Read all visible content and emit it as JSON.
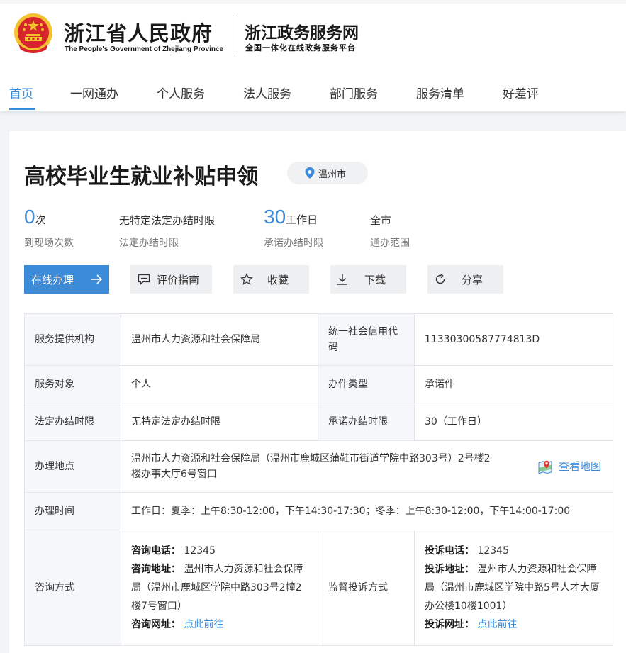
{
  "header": {
    "gov_name": "浙江省人民政府",
    "gov_name_en": "The People's Government of Zhejiang Province",
    "portal_name": "浙江政务服务网",
    "portal_subtitle": "全国一体化在线政务服务平台"
  },
  "nav": {
    "items": [
      {
        "label": "首页",
        "active": true
      },
      {
        "label": "一网通办"
      },
      {
        "label": "个人服务"
      },
      {
        "label": "法人服务"
      },
      {
        "label": "部门服务"
      },
      {
        "label": "服务清单"
      },
      {
        "label": "好差评"
      }
    ]
  },
  "service": {
    "title": "高校毕业生就业补贴申领",
    "location": "温州市",
    "stats": [
      {
        "value": "0",
        "unit": "次",
        "label": "到现场次数"
      },
      {
        "value": "",
        "unit": "无特定法定办结时限",
        "label": "法定办结时限"
      },
      {
        "value": "30",
        "unit": "工作日",
        "label": "承诺办结时限"
      },
      {
        "value": "",
        "unit": "全市",
        "label": "通办范围"
      }
    ]
  },
  "actions": {
    "online": "在线办理",
    "guide": "评价指南",
    "favorite": "收藏",
    "download": "下载",
    "share": "分享"
  },
  "info": {
    "provider_label": "服务提供机构",
    "provider": "温州市人力资源和社会保障局",
    "credit_label": "统一社会信用代码",
    "credit_code": "11330300587774813D",
    "target_label": "服务对象",
    "target": "个人",
    "type_label": "办件类型",
    "type": "承诺件",
    "legal_limit_label": "法定办结时限",
    "legal_limit": "无特定法定办结时限",
    "promise_limit_label": "承诺办结时限",
    "promise_limit": "30（工作日）",
    "place_label": "办理地点",
    "place": "温州市人力资源和社会保障局（温州市鹿城区蒲鞋市街道学院中路303号）2号楼2楼办事大厅6号窗口",
    "view_map": "查看地图",
    "time_label": "办理时间",
    "time": "工作日：夏季：上午8:30-12:00，下午14:30-17:30；冬季：上午8:30-12:00，下午14:00-17:00",
    "consult_label": "咨询方式",
    "consult": {
      "phone_key": "咨询电话：",
      "phone": "12345",
      "address_key": "咨询地址：",
      "address": "温州市人力资源和社会保障局（温州市鹿城区学院中路303号2幢2楼7号窗口）",
      "url_key": "咨询网址：",
      "url_text": "点此前往"
    },
    "complaint_label": "监督投诉方式",
    "complaint": {
      "phone_key": "投诉电话：",
      "phone": "12345",
      "address_key": "投诉地址：",
      "address": "温州市人力资源和社会保障局（温州市鹿城区学院中路5号人才大厦办公楼10楼1001）",
      "url_key": "投诉网址：",
      "url_text": "点此前往"
    }
  },
  "colors": {
    "accent": "#3c8bd9",
    "emblem_red": "#d7262b",
    "emblem_gold": "#f2c230"
  }
}
